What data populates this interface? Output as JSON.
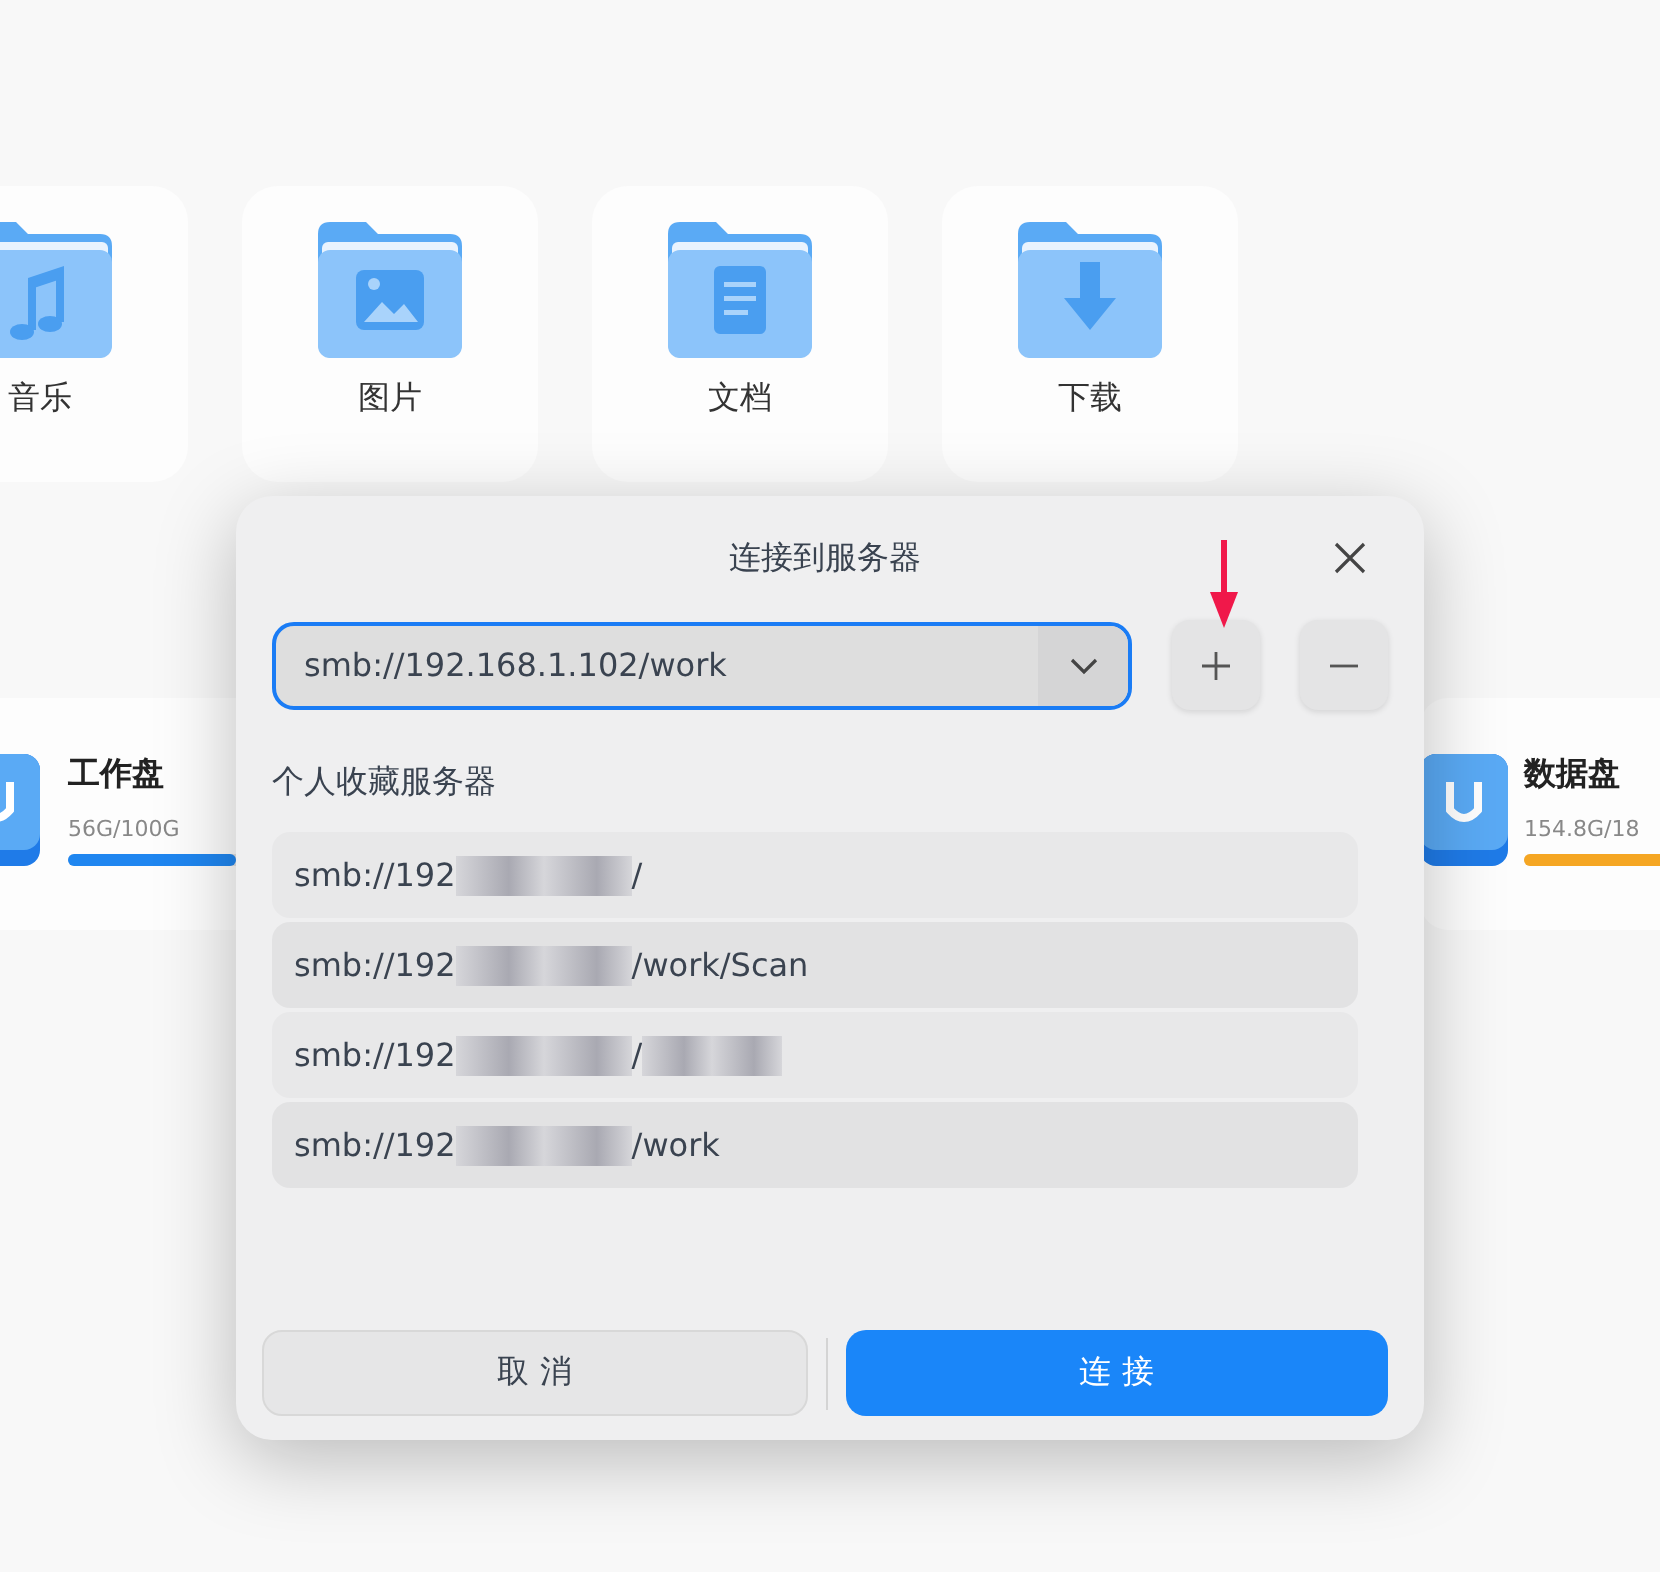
{
  "folders": [
    {
      "label": "音乐",
      "kind": "music"
    },
    {
      "label": "图片",
      "kind": "image"
    },
    {
      "label": "文档",
      "kind": "document"
    },
    {
      "label": "下载",
      "kind": "download"
    }
  ],
  "disks": [
    {
      "name": "工作盘",
      "usage": "56G/100G",
      "level": 0.56,
      "color": "#1f86f0"
    },
    {
      "name": "数据盘",
      "usage": "154.8G/18",
      "level": 0.83,
      "color": "#f5a623"
    }
  ],
  "dialog": {
    "title": "连接到服务器",
    "address": "smb://192.168.1.102/work",
    "section_label": "个人收藏服务器",
    "favorites": [
      {
        "prefix": "smb://192",
        "suffix": "/"
      },
      {
        "prefix": "smb://192",
        "suffix": "/work/Scan"
      },
      {
        "prefix": "smb://192",
        "suffix": "/"
      },
      {
        "prefix": "smb://192",
        "suffix": "/work"
      }
    ],
    "cancel": "取 消",
    "connect": "连 接"
  }
}
